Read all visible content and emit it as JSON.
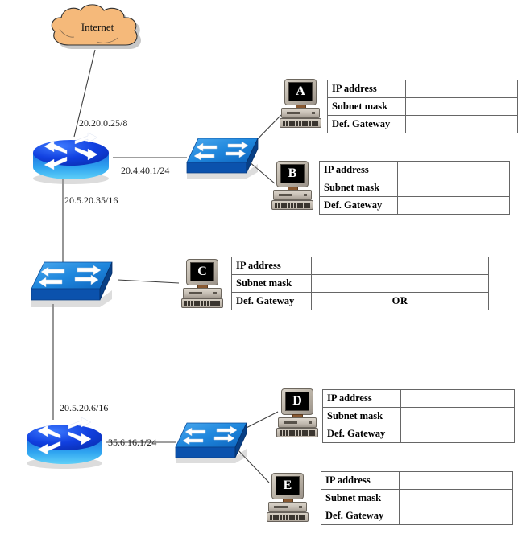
{
  "diagram": {
    "title": "Network topology with host IP configuration tables",
    "cloud": {
      "label": "Internet",
      "fill": "#f5b97a",
      "stroke": "#3a3a3a"
    }
  },
  "table_headers": {
    "ip": "IP address",
    "mask": "Subnet mask",
    "gateway": "Def. Gateway"
  },
  "hosts": [
    {
      "id": "A",
      "letter": "A",
      "table": {
        "ip_value": "",
        "mask_value": "",
        "gateway_value": ""
      }
    },
    {
      "id": "B",
      "letter": "B",
      "table": {
        "ip_value": "",
        "mask_value": "",
        "gateway_value": ""
      }
    },
    {
      "id": "C",
      "letter": "C",
      "table": {
        "ip_value": "",
        "mask_value": "",
        "gateway_value": "OR"
      }
    },
    {
      "id": "D",
      "letter": "D",
      "table": {
        "ip_value": "",
        "mask_value": "",
        "gateway_value": ""
      }
    },
    {
      "id": "E",
      "letter": "E",
      "table": {
        "ip_value": "",
        "mask_value": "",
        "gateway_value": ""
      }
    }
  ],
  "routers": [
    {
      "id": "router-top",
      "interfaces": [
        {
          "label": "20.20.0.25/8"
        },
        {
          "label": "20.4.40.1/24"
        },
        {
          "label": "20.5.20.35/16"
        }
      ]
    },
    {
      "id": "router-bottom",
      "interfaces": [
        {
          "label": "20.5.20.6/16"
        },
        {
          "label": "35.6.16.1/24"
        }
      ]
    }
  ],
  "interface_labels": {
    "top_uplink": "20.20.0.25/8",
    "top_lan": "20.4.40.1/24",
    "top_downlink": "20.5.20.35/16",
    "bottom_uplink": "20.5.20.6/16",
    "bottom_lan": "35.6.16.1/24"
  },
  "switches": [
    {
      "id": "switch-top"
    },
    {
      "id": "switch-middle"
    },
    {
      "id": "switch-bottom"
    }
  ],
  "colors": {
    "switch_top_face": "#2f8ddd",
    "switch_side": "#0b4ea2",
    "router_top": "#1550e8",
    "router_side": "#35aef0",
    "line": "#3f3f3f",
    "cloud": "#f5b97a"
  }
}
